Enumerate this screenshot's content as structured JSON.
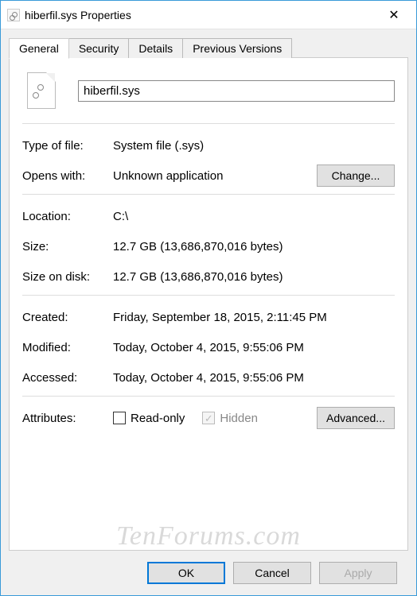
{
  "window": {
    "title": "hiberfil.sys Properties",
    "close_glyph": "✕"
  },
  "tabs": {
    "general": "General",
    "security": "Security",
    "details": "Details",
    "previous": "Previous Versions"
  },
  "file": {
    "name": "hiberfil.sys"
  },
  "labels": {
    "type": "Type of file:",
    "opens": "Opens with:",
    "change": "Change...",
    "location": "Location:",
    "size": "Size:",
    "size_on_disk": "Size on disk:",
    "created": "Created:",
    "modified": "Modified:",
    "accessed": "Accessed:",
    "attributes": "Attributes:",
    "readonly": "Read-only",
    "hidden": "Hidden",
    "advanced": "Advanced..."
  },
  "values": {
    "type": "System file (.sys)",
    "opens": "Unknown application",
    "location": "C:\\",
    "size": "12.7 GB (13,686,870,016 bytes)",
    "size_on_disk": "12.7 GB (13,686,870,016 bytes)",
    "created": "Friday, September 18, 2015, 2:11:45 PM",
    "modified": "Today, October 4, 2015, 9:55:06 PM",
    "accessed": "Today, October 4, 2015, 9:55:06 PM"
  },
  "attributes": {
    "readonly_checked": false,
    "hidden_checked": true,
    "hidden_disabled": true,
    "hidden_glyph": "✓"
  },
  "footer": {
    "ok": "OK",
    "cancel": "Cancel",
    "apply": "Apply"
  },
  "watermark": "TenForums.com"
}
